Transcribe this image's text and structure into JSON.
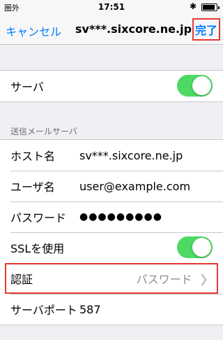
{
  "status_bar": {
    "carrier": "圏外",
    "time": "17:51",
    "bluetooth": "✱"
  },
  "nav": {
    "cancel_label": "キャンセル",
    "title": "sv***.sixcore.ne.jp",
    "done_label": "完了"
  },
  "server_group": {
    "server_label": "サーバ",
    "server_enabled": true
  },
  "outgoing": {
    "section_title": "送信メールサーバ",
    "host_label": "ホスト名",
    "host_value": "sv***.sixcore.ne.jp",
    "user_label": "ユーザ名",
    "user_value": "user@example.com",
    "password_label": "パスワード",
    "password_value": "●●●●●●●●●",
    "ssl_label": "SSLを使用",
    "ssl_enabled": true,
    "auth_label": "認証",
    "auth_value": "パスワード",
    "port_label": "サーバポート",
    "port_value": "587"
  },
  "colors": {
    "accent": "#007aff",
    "toggle_on": "#4cd964",
    "highlight_box": "#e53935"
  }
}
